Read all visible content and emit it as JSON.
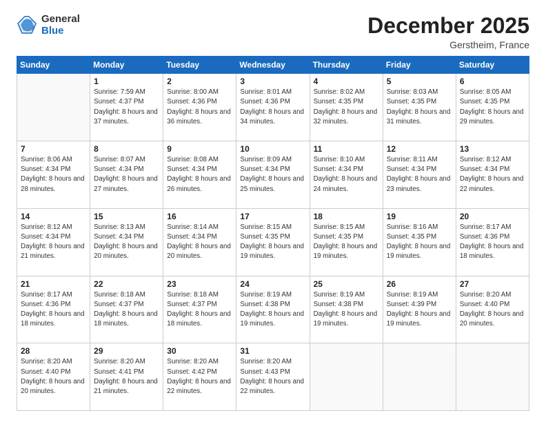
{
  "logo": {
    "general": "General",
    "blue": "Blue"
  },
  "title": "December 2025",
  "subtitle": "Gerstheim, France",
  "days_header": [
    "Sunday",
    "Monday",
    "Tuesday",
    "Wednesday",
    "Thursday",
    "Friday",
    "Saturday"
  ],
  "weeks": [
    [
      {
        "day": "",
        "sunrise": "",
        "sunset": "",
        "daylight": ""
      },
      {
        "day": "1",
        "sunrise": "Sunrise: 7:59 AM",
        "sunset": "Sunset: 4:37 PM",
        "daylight": "Daylight: 8 hours and 37 minutes."
      },
      {
        "day": "2",
        "sunrise": "Sunrise: 8:00 AM",
        "sunset": "Sunset: 4:36 PM",
        "daylight": "Daylight: 8 hours and 36 minutes."
      },
      {
        "day": "3",
        "sunrise": "Sunrise: 8:01 AM",
        "sunset": "Sunset: 4:36 PM",
        "daylight": "Daylight: 8 hours and 34 minutes."
      },
      {
        "day": "4",
        "sunrise": "Sunrise: 8:02 AM",
        "sunset": "Sunset: 4:35 PM",
        "daylight": "Daylight: 8 hours and 32 minutes."
      },
      {
        "day": "5",
        "sunrise": "Sunrise: 8:03 AM",
        "sunset": "Sunset: 4:35 PM",
        "daylight": "Daylight: 8 hours and 31 minutes."
      },
      {
        "day": "6",
        "sunrise": "Sunrise: 8:05 AM",
        "sunset": "Sunset: 4:35 PM",
        "daylight": "Daylight: 8 hours and 29 minutes."
      }
    ],
    [
      {
        "day": "7",
        "sunrise": "Sunrise: 8:06 AM",
        "sunset": "Sunset: 4:34 PM",
        "daylight": "Daylight: 8 hours and 28 minutes."
      },
      {
        "day": "8",
        "sunrise": "Sunrise: 8:07 AM",
        "sunset": "Sunset: 4:34 PM",
        "daylight": "Daylight: 8 hours and 27 minutes."
      },
      {
        "day": "9",
        "sunrise": "Sunrise: 8:08 AM",
        "sunset": "Sunset: 4:34 PM",
        "daylight": "Daylight: 8 hours and 26 minutes."
      },
      {
        "day": "10",
        "sunrise": "Sunrise: 8:09 AM",
        "sunset": "Sunset: 4:34 PM",
        "daylight": "Daylight: 8 hours and 25 minutes."
      },
      {
        "day": "11",
        "sunrise": "Sunrise: 8:10 AM",
        "sunset": "Sunset: 4:34 PM",
        "daylight": "Daylight: 8 hours and 24 minutes."
      },
      {
        "day": "12",
        "sunrise": "Sunrise: 8:11 AM",
        "sunset": "Sunset: 4:34 PM",
        "daylight": "Daylight: 8 hours and 23 minutes."
      },
      {
        "day": "13",
        "sunrise": "Sunrise: 8:12 AM",
        "sunset": "Sunset: 4:34 PM",
        "daylight": "Daylight: 8 hours and 22 minutes."
      }
    ],
    [
      {
        "day": "14",
        "sunrise": "Sunrise: 8:12 AM",
        "sunset": "Sunset: 4:34 PM",
        "daylight": "Daylight: 8 hours and 21 minutes."
      },
      {
        "day": "15",
        "sunrise": "Sunrise: 8:13 AM",
        "sunset": "Sunset: 4:34 PM",
        "daylight": "Daylight: 8 hours and 20 minutes."
      },
      {
        "day": "16",
        "sunrise": "Sunrise: 8:14 AM",
        "sunset": "Sunset: 4:34 PM",
        "daylight": "Daylight: 8 hours and 20 minutes."
      },
      {
        "day": "17",
        "sunrise": "Sunrise: 8:15 AM",
        "sunset": "Sunset: 4:35 PM",
        "daylight": "Daylight: 8 hours and 19 minutes."
      },
      {
        "day": "18",
        "sunrise": "Sunrise: 8:15 AM",
        "sunset": "Sunset: 4:35 PM",
        "daylight": "Daylight: 8 hours and 19 minutes."
      },
      {
        "day": "19",
        "sunrise": "Sunrise: 8:16 AM",
        "sunset": "Sunset: 4:35 PM",
        "daylight": "Daylight: 8 hours and 19 minutes."
      },
      {
        "day": "20",
        "sunrise": "Sunrise: 8:17 AM",
        "sunset": "Sunset: 4:36 PM",
        "daylight": "Daylight: 8 hours and 18 minutes."
      }
    ],
    [
      {
        "day": "21",
        "sunrise": "Sunrise: 8:17 AM",
        "sunset": "Sunset: 4:36 PM",
        "daylight": "Daylight: 8 hours and 18 minutes."
      },
      {
        "day": "22",
        "sunrise": "Sunrise: 8:18 AM",
        "sunset": "Sunset: 4:37 PM",
        "daylight": "Daylight: 8 hours and 18 minutes."
      },
      {
        "day": "23",
        "sunrise": "Sunrise: 8:18 AM",
        "sunset": "Sunset: 4:37 PM",
        "daylight": "Daylight: 8 hours and 18 minutes."
      },
      {
        "day": "24",
        "sunrise": "Sunrise: 8:19 AM",
        "sunset": "Sunset: 4:38 PM",
        "daylight": "Daylight: 8 hours and 19 minutes."
      },
      {
        "day": "25",
        "sunrise": "Sunrise: 8:19 AM",
        "sunset": "Sunset: 4:38 PM",
        "daylight": "Daylight: 8 hours and 19 minutes."
      },
      {
        "day": "26",
        "sunrise": "Sunrise: 8:19 AM",
        "sunset": "Sunset: 4:39 PM",
        "daylight": "Daylight: 8 hours and 19 minutes."
      },
      {
        "day": "27",
        "sunrise": "Sunrise: 8:20 AM",
        "sunset": "Sunset: 4:40 PM",
        "daylight": "Daylight: 8 hours and 20 minutes."
      }
    ],
    [
      {
        "day": "28",
        "sunrise": "Sunrise: 8:20 AM",
        "sunset": "Sunset: 4:40 PM",
        "daylight": "Daylight: 8 hours and 20 minutes."
      },
      {
        "day": "29",
        "sunrise": "Sunrise: 8:20 AM",
        "sunset": "Sunset: 4:41 PM",
        "daylight": "Daylight: 8 hours and 21 minutes."
      },
      {
        "day": "30",
        "sunrise": "Sunrise: 8:20 AM",
        "sunset": "Sunset: 4:42 PM",
        "daylight": "Daylight: 8 hours and 22 minutes."
      },
      {
        "day": "31",
        "sunrise": "Sunrise: 8:20 AM",
        "sunset": "Sunset: 4:43 PM",
        "daylight": "Daylight: 8 hours and 22 minutes."
      },
      {
        "day": "",
        "sunrise": "",
        "sunset": "",
        "daylight": ""
      },
      {
        "day": "",
        "sunrise": "",
        "sunset": "",
        "daylight": ""
      },
      {
        "day": "",
        "sunrise": "",
        "sunset": "",
        "daylight": ""
      }
    ]
  ]
}
